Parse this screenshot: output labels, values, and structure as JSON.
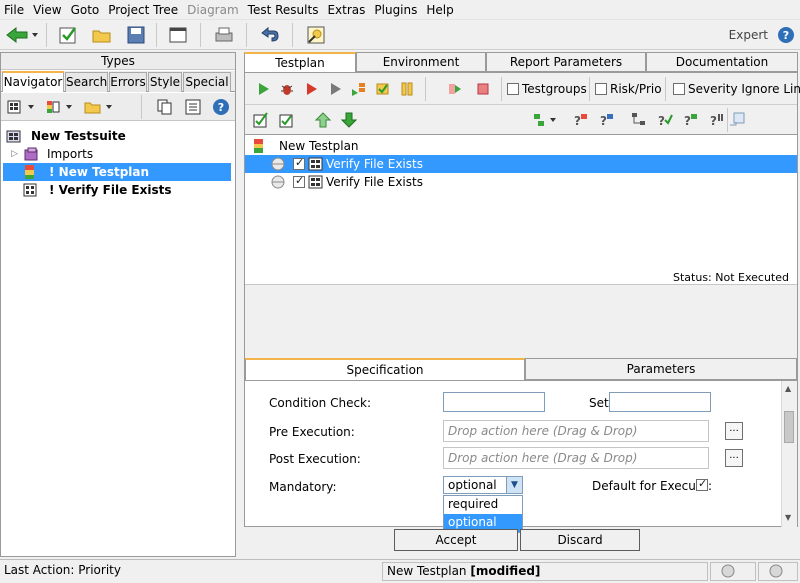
{
  "menu": [
    "File",
    "View",
    "Goto",
    "Project Tree",
    "Diagram",
    "Test Results",
    "Extras",
    "Plugins",
    "Help"
  ],
  "menu_disabled": [
    "Diagram"
  ],
  "toolbar": {
    "icons": [
      "back-arrow-icon",
      "check-icon",
      "open-folder-icon",
      "save-icon",
      "window-icon",
      "print-icon",
      "undo-icon",
      "wizard-icon"
    ],
    "mode_label": "Expert",
    "help": "?"
  },
  "left_panel": {
    "header": "Types",
    "tabs": [
      "Navigator",
      "Search",
      "Errors",
      "Style",
      "Special"
    ],
    "tree": [
      {
        "label": "New Testsuite",
        "bold": true
      },
      {
        "label": "Imports",
        "bold": false
      },
      {
        "label": "! New Testplan",
        "bold": true,
        "selected": true
      },
      {
        "label": "! Verify File Exists",
        "bold": true
      }
    ]
  },
  "right_panel": {
    "tabs": [
      "Testplan",
      "Environment",
      "Report Parameters",
      "Documentation"
    ],
    "checkbox_options": [
      "Testgroups",
      "Risk/Prio",
      "Severity Ignore Lin"
    ],
    "plan_title": "New Testplan",
    "plan_rows": [
      {
        "label": "Verify File Exists",
        "selected": true
      },
      {
        "label": "Verify File Exists",
        "selected": false
      }
    ],
    "status": "Status: Not Executed",
    "sub_tabs": [
      "Specification",
      "Parameters"
    ],
    "spec": {
      "condition_check_label": "Condition Check:",
      "set_label": "Set:",
      "pre_exec_label": "Pre Execution:",
      "post_exec_label": "Post Execution:",
      "drop_placeholder": "Drop action here (Drag & Drop)",
      "mandatory_label": "Mandatory:",
      "mandatory_value": "optional",
      "mandatory_options": [
        "required",
        "optional"
      ],
      "default_execute_label": "Default for Execute:"
    },
    "accept": "Accept",
    "discard": "Discard"
  },
  "statusbar": {
    "last_action": "Last Action: Priority",
    "doc_name": "New Testplan",
    "doc_state": "[modified]"
  }
}
